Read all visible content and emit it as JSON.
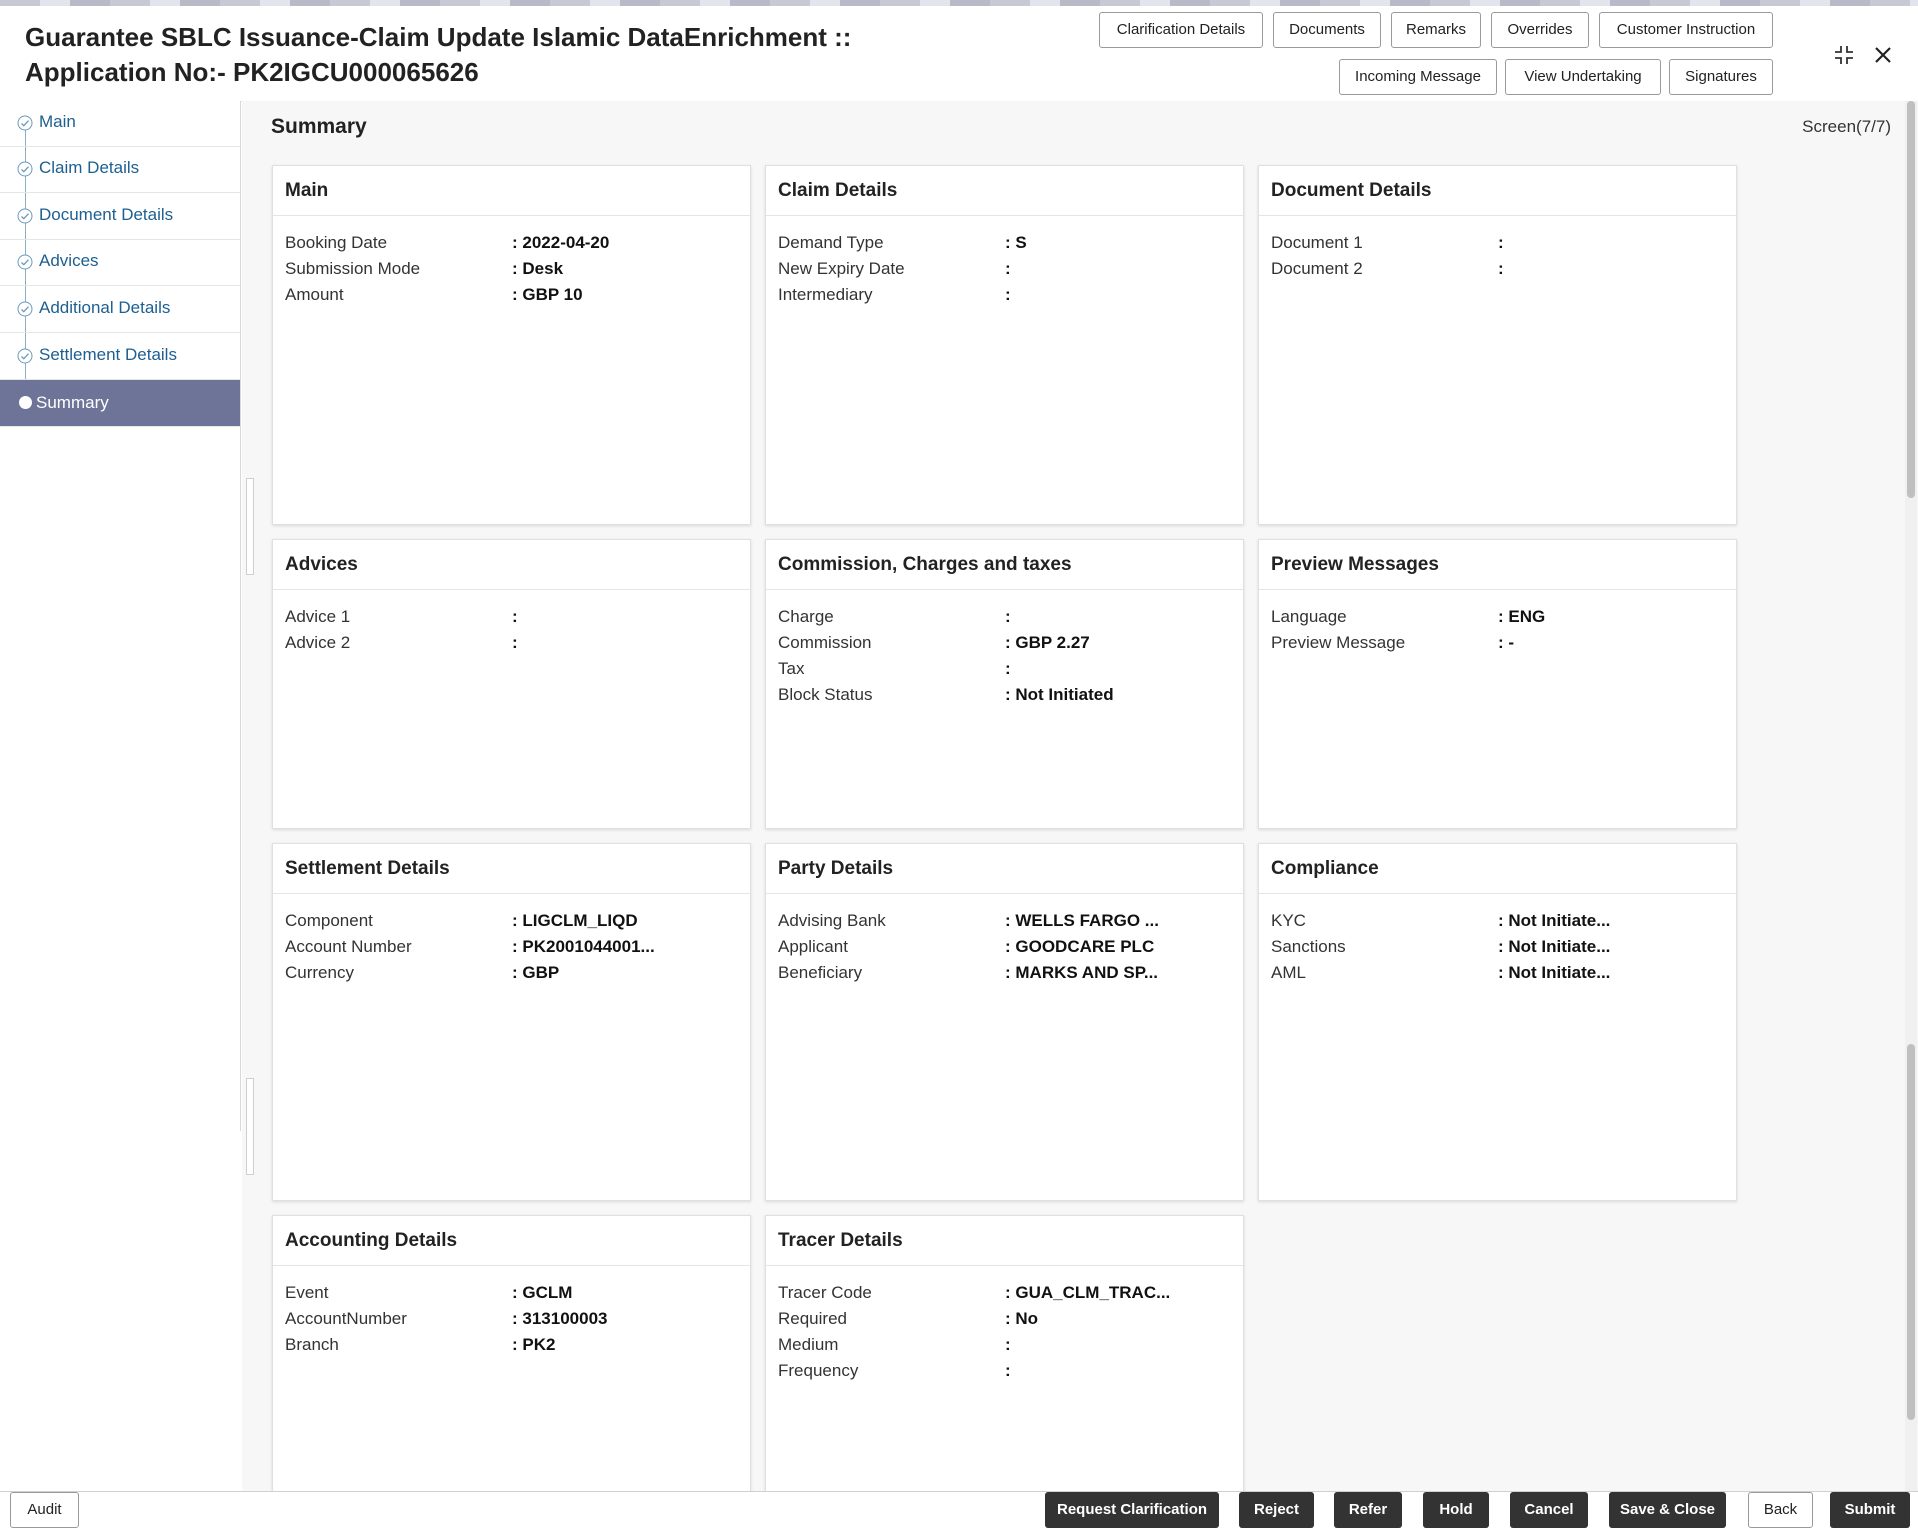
{
  "header": {
    "title_line1": "Guarantee SBLC Issuance-Claim Update Islamic DataEnrichment ::",
    "title_line2": "Application No:- PK2IGCU000065626",
    "buttons_row1": [
      "Clarification Details",
      "Documents",
      "Remarks",
      "Overrides",
      "Customer Instruction"
    ],
    "buttons_row2": [
      "Incoming Message",
      "View Undertaking",
      "Signatures"
    ]
  },
  "sidebar": {
    "items": [
      {
        "label": "Main"
      },
      {
        "label": "Claim Details"
      },
      {
        "label": "Document Details"
      },
      {
        "label": "Advices"
      },
      {
        "label": "Additional Details"
      },
      {
        "label": "Settlement Details"
      },
      {
        "label": "Summary"
      }
    ]
  },
  "main": {
    "title": "Summary",
    "screen": "Screen(7/7)"
  },
  "cards": [
    {
      "title": "Main",
      "rows": [
        {
          "k": "Booking Date",
          "v": ": 2022-04-20"
        },
        {
          "k": "Submission Mode",
          "v": ": Desk"
        },
        {
          "k": "Amount",
          "v": ": GBP 10"
        }
      ]
    },
    {
      "title": "Claim Details",
      "rows": [
        {
          "k": "Demand Type",
          "v": ": S"
        },
        {
          "k": "New Expiry Date",
          "v": ":"
        },
        {
          "k": "Intermediary",
          "v": ":"
        }
      ]
    },
    {
      "title": "Document Details",
      "rows": [
        {
          "k": "Document 1",
          "v": ":"
        },
        {
          "k": "Document 2",
          "v": ":"
        }
      ]
    },
    {
      "title": "Advices",
      "rows": [
        {
          "k": "Advice 1",
          "v": ":"
        },
        {
          "k": "Advice 2",
          "v": ":"
        }
      ]
    },
    {
      "title": "Commission, Charges and taxes",
      "rows": [
        {
          "k": "Charge",
          "v": ":"
        },
        {
          "k": "Commission",
          "v": ": GBP  2.27"
        },
        {
          "k": "Tax",
          "v": ":"
        },
        {
          "k": "Block Status",
          "v": ": Not Initiated"
        }
      ]
    },
    {
      "title": "Preview Messages",
      "rows": [
        {
          "k": "Language",
          "v": ": ENG"
        },
        {
          "k": "Preview Message",
          "v": ": -"
        }
      ]
    },
    {
      "title": "Settlement Details",
      "rows": [
        {
          "k": "Component",
          "v": ": LIGCLM_LIQD"
        },
        {
          "k": "Account Number",
          "v": ": PK2001044001..."
        },
        {
          "k": "Currency",
          "v": ": GBP"
        }
      ]
    },
    {
      "title": "Party Details",
      "rows": [
        {
          "k": "Advising Bank",
          "v": ": WELLS FARGO ..."
        },
        {
          "k": "Applicant",
          "v": ": GOODCARE PLC"
        },
        {
          "k": "Beneficiary",
          "v": ": MARKS AND SP..."
        }
      ]
    },
    {
      "title": "Compliance",
      "rows": [
        {
          "k": "KYC",
          "v": ": Not Initiate..."
        },
        {
          "k": "Sanctions",
          "v": ": Not Initiate..."
        },
        {
          "k": "AML",
          "v": ": Not Initiate..."
        }
      ]
    },
    {
      "title": "Accounting Details",
      "rows": [
        {
          "k": "Event",
          "v": ": GCLM"
        },
        {
          "k": "AccountNumber",
          "v": ": 313100003"
        },
        {
          "k": "Branch",
          "v": ": PK2"
        }
      ]
    },
    {
      "title": "Tracer Details",
      "rows": [
        {
          "k": "Tracer Code",
          "v": ": GUA_CLM_TRAC..."
        },
        {
          "k": "Required",
          "v": ": No"
        },
        {
          "k": "Medium",
          "v": ":"
        },
        {
          "k": "Frequency",
          "v": ":"
        }
      ]
    }
  ],
  "footer": {
    "audit": "Audit",
    "buttons": [
      "Request Clarification",
      "Reject",
      "Refer",
      "Hold",
      "Cancel",
      "Save & Close",
      "Back",
      "Submit"
    ]
  },
  "icons": {
    "minimize": "collapse-arrows-icon",
    "close": "close-icon",
    "check": "check-circle-icon"
  }
}
